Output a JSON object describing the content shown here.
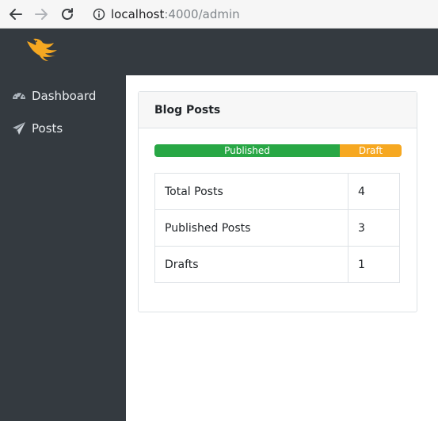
{
  "browser": {
    "url_host": "localhost",
    "url_path": ":4000/admin"
  },
  "icons": {
    "back": "arrow-left-icon",
    "forward": "arrow-right-icon",
    "reload": "reload-icon",
    "info": "info-icon",
    "logo": "phoenix-logo",
    "dashboard": "tachometer-icon",
    "posts": "paper-plane-icon"
  },
  "colors": {
    "sidebar": "#343a40",
    "published": "#28a745",
    "draft": "#f6a821",
    "logo": "#f6a821"
  },
  "sidebar": {
    "items": [
      {
        "label": "Dashboard"
      },
      {
        "label": "Posts"
      }
    ]
  },
  "card": {
    "title": "Blog Posts",
    "progress": [
      {
        "label": "Published",
        "value": 3,
        "fraction": 0.75
      },
      {
        "label": "Draft",
        "value": 1,
        "fraction": 0.25
      }
    ],
    "rows": [
      {
        "label": "Total Posts",
        "value": "4"
      },
      {
        "label": "Published Posts",
        "value": "3"
      },
      {
        "label": "Drafts",
        "value": "1"
      }
    ]
  }
}
